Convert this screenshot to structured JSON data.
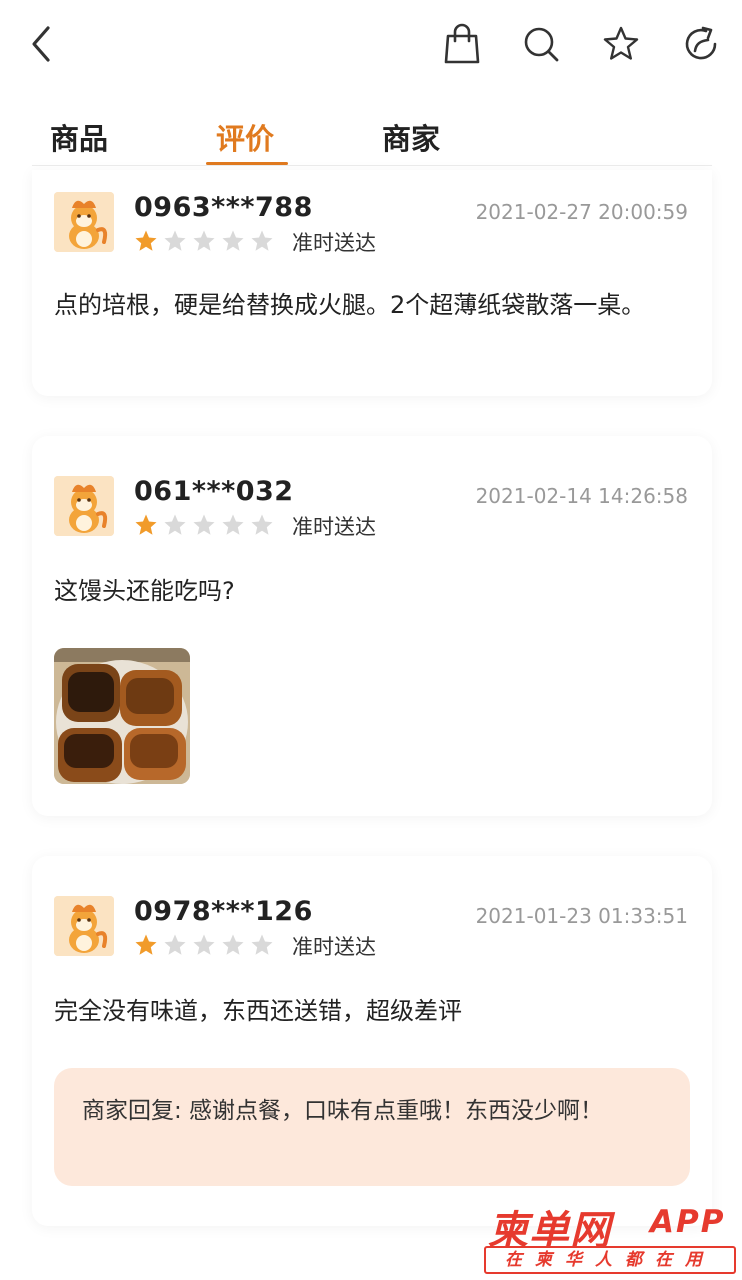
{
  "tabs": [
    {
      "label": "商品"
    },
    {
      "label": "评价"
    },
    {
      "label": "商家"
    }
  ],
  "active_tab": "评价",
  "accent_color": "#e07a1f",
  "star_active_color": "#f19b2a",
  "star_inactive_color": "#d9d9d9",
  "icons": [
    "back-arrow-icon",
    "shopping-bag-icon",
    "search-icon",
    "star-favorite-icon",
    "share-icon"
  ],
  "reviews": [
    {
      "user": "0963***788",
      "date": "2021-02-27 20:00:59",
      "rating": 1,
      "rating_max": 5,
      "delivery": "准时送达",
      "content": "点的培根，硬是给替换成火腿。2个超薄纸袋散落一桌。"
    },
    {
      "user": "061***032",
      "date": "2021-02-14 14:26:58",
      "rating": 1,
      "rating_max": 5,
      "delivery": "准时送达",
      "content": "这馒头还能吃吗?"
    },
    {
      "user": "0978***126",
      "date": "2021-01-23 01:33:51",
      "rating": 1,
      "rating_max": 5,
      "delivery": "准时送达",
      "content": "完全没有味道，东西还送错，超级差评",
      "reply": "商家回复: 感谢点餐，口味有点重哦！东西没少啊！"
    }
  ],
  "watermark": {
    "title": "柬单网",
    "app": "APP",
    "slogan": "在柬华人都在用"
  }
}
